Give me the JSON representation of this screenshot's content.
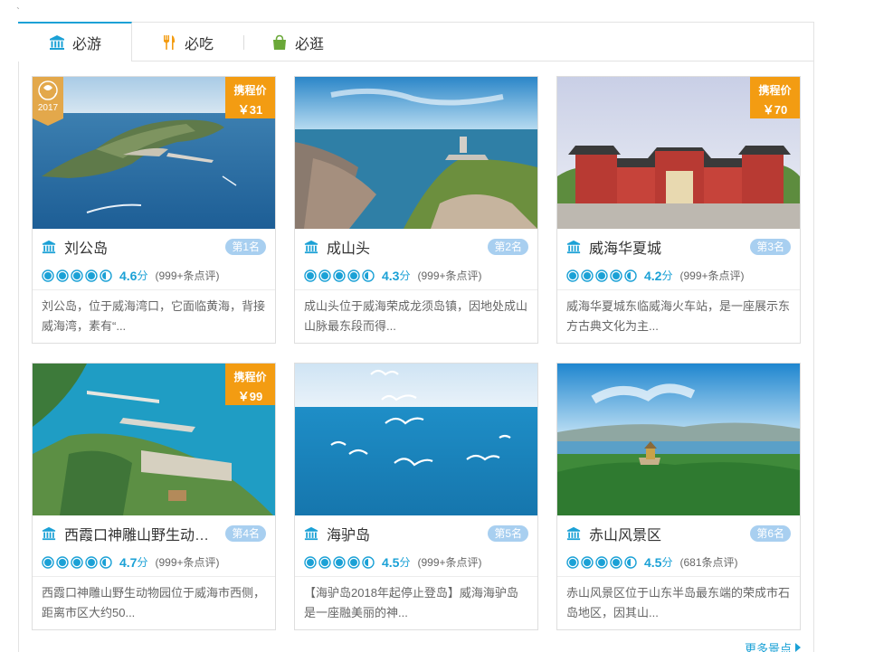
{
  "stray_mark": "`",
  "tabs": [
    {
      "label": "必游",
      "icon": "museum-icon",
      "active": true
    },
    {
      "label": "必吃",
      "icon": "fork-knife-icon",
      "active": false
    },
    {
      "label": "必逛",
      "icon": "shopping-bag-icon",
      "active": false
    }
  ],
  "colors": {
    "accent": "#1ba1d6",
    "price_tag": "#f39c12",
    "rank_pill": "#a8cff0",
    "tab_bag": "#6aa838",
    "tab_fork": "#f39c12"
  },
  "price_label": "携程价",
  "award_year": "2017",
  "cards": [
    {
      "name": "刘公岛",
      "rank": "第1名",
      "score": "4.6",
      "score_unit": "分",
      "reviews": "(999+条点评)",
      "rating": 4.6,
      "desc": "刘公岛，位于威海湾口，它面临黄海，背接威海湾，素有“...",
      "price": "￥31",
      "icon": "museum-icon",
      "award": true
    },
    {
      "name": "成山头",
      "rank": "第2名",
      "score": "4.3",
      "score_unit": "分",
      "reviews": "(999+条点评)",
      "rating": 4.3,
      "desc": "成山头位于威海荣成龙须岛镇，因地处成山山脉最东段而得...",
      "price": "",
      "icon": "museum-icon",
      "award": false
    },
    {
      "name": "威海华夏城",
      "rank": "第3名",
      "score": "4.2",
      "score_unit": "分",
      "reviews": "(999+条点评)",
      "rating": 4.2,
      "desc": "威海华夏城东临威海火车站，是一座展示东方古典文化为主...",
      "price": "￥70",
      "icon": "museum-icon",
      "award": false
    },
    {
      "name": "西霞口神雕山野生动物...",
      "rank": "第4名",
      "score": "4.7",
      "score_unit": "分",
      "reviews": "(999+条点评)",
      "rating": 4.7,
      "desc": "西霞口神雕山野生动物园位于威海市西侧，距离市区大约50...",
      "price": "￥99",
      "icon": "museum-icon",
      "award": false
    },
    {
      "name": "海驴岛",
      "rank": "第5名",
      "score": "4.5",
      "score_unit": "分",
      "reviews": "(999+条点评)",
      "rating": 4.5,
      "desc": "【海驴岛2018年起停止登岛】威海海驴岛是一座融美丽的神...",
      "price": "",
      "icon": "museum-icon",
      "award": false
    },
    {
      "name": "赤山风景区",
      "rank": "第6名",
      "score": "4.5",
      "score_unit": "分",
      "reviews": "(681条点评)",
      "rating": 4.5,
      "desc": "赤山风景区位于山东半岛最东端的荣成市石岛地区，因其山...",
      "price": "",
      "icon": "museum-icon",
      "award": false
    }
  ],
  "more_link": "更多景点"
}
